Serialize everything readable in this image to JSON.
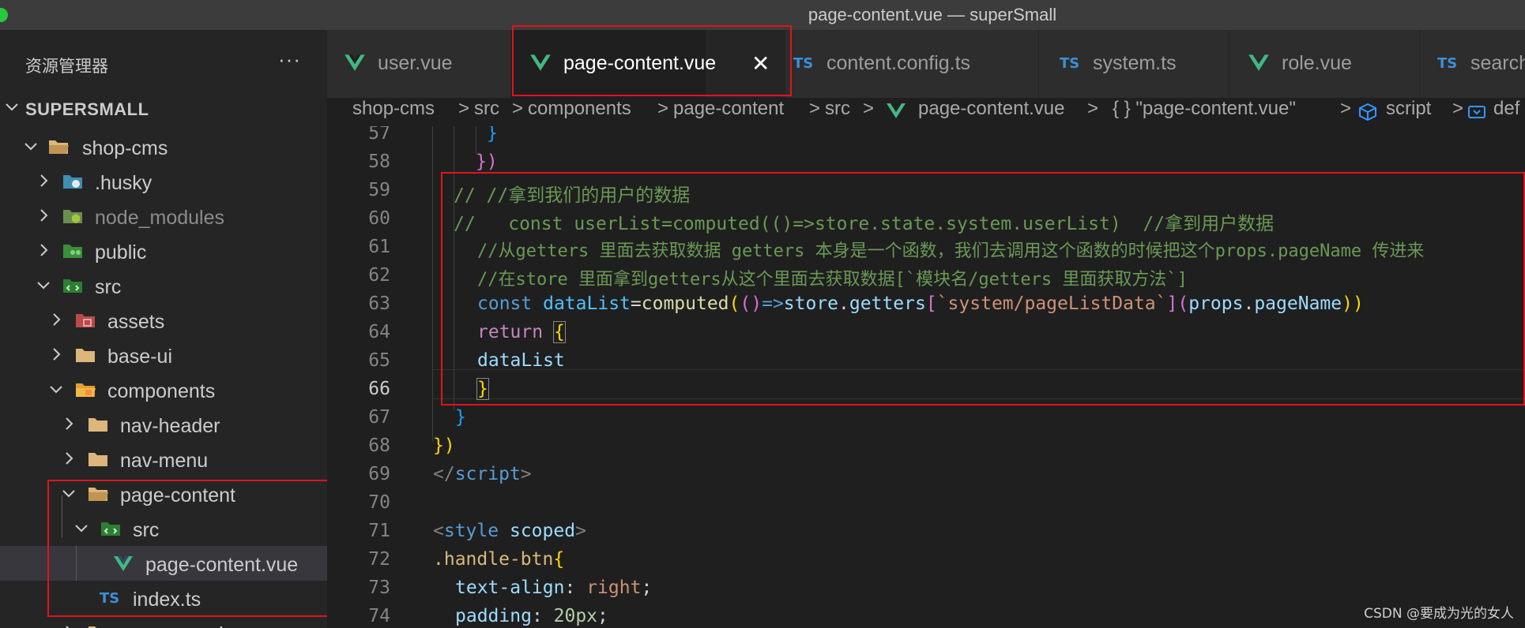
{
  "window": {
    "title": "page-content.vue — superSmall"
  },
  "explorer": {
    "title": "资源管理器",
    "more": "···",
    "project": "SUPERSMALL",
    "items": [
      {
        "label": "shop-cms"
      },
      {
        "label": ".husky"
      },
      {
        "label": "node_modules"
      },
      {
        "label": "public"
      },
      {
        "label": "src"
      },
      {
        "label": "assets"
      },
      {
        "label": "base-ui"
      },
      {
        "label": "components"
      },
      {
        "label": "nav-header"
      },
      {
        "label": "nav-menu"
      },
      {
        "label": "page-content"
      },
      {
        "label": "src"
      },
      {
        "label": "page-content.vue"
      },
      {
        "label": "index.ts"
      },
      {
        "label": "page-search"
      }
    ]
  },
  "tabs": [
    {
      "label": "user.vue",
      "icon": "vue-icon"
    },
    {
      "label": "page-content.vue",
      "icon": "vue-icon",
      "close": "✕"
    },
    {
      "label": "content.config.ts",
      "icon": "ts-icon",
      "badge": "TS"
    },
    {
      "label": "system.ts",
      "icon": "ts-icon",
      "badge": "TS"
    },
    {
      "label": "role.vue",
      "icon": "vue-icon"
    },
    {
      "label": "search",
      "icon": "ts-icon",
      "badge": "TS"
    }
  ],
  "breadcrumb": {
    "items": [
      "shop-cms",
      "src",
      "components",
      "page-content",
      "src",
      "page-content.vue",
      "{ } \"page-content.vue\"",
      "script",
      "def"
    ],
    "sep": ">"
  },
  "editor": {
    "current_line": 66,
    "lines": [
      {
        "n": "57",
        "t": "}"
      },
      {
        "n": "58",
        "t": "})"
      },
      {
        "n": "59",
        "t": "// //拿到我们的用户的数据"
      },
      {
        "n": "60",
        "t": "//   const userList=computed(()=>store.state.system.userList)  //拿到用户数据"
      },
      {
        "n": "61",
        "t": "//从getters 里面去获取数据 getters 本身是一个函数，我们去调用这个函数的时候把这个props.pageName 传进来"
      },
      {
        "n": "62",
        "t": "//在store 里面拿到getters从这个里面去获取数据[`模块名/getters 里面获取方法`]"
      },
      {
        "n": "63",
        "a": "const",
        "b": "dataList",
        "c": "=",
        "d": "computed",
        "e": "(",
        "f": "()",
        "g": "=>",
        "h": "store",
        "i": ".",
        "j": "getters",
        "k": "[",
        "l": "`system/pageListData`",
        "m": "]",
        "o": "(",
        "p": "props",
        "q": ".",
        "r": "pageName",
        "s": "))"
      },
      {
        "n": "64",
        "a": "return",
        "b": "{"
      },
      {
        "n": "65",
        "t": "dataList"
      },
      {
        "n": "66",
        "t": "}"
      },
      {
        "n": "67",
        "t": "}"
      },
      {
        "n": "68",
        "t": "})"
      },
      {
        "n": "69",
        "a": "</",
        "b": "script",
        "c": ">"
      },
      {
        "n": "70",
        "t": ""
      },
      {
        "n": "71",
        "a": "<",
        "b": "style",
        "c": "scoped",
        "d": ">"
      },
      {
        "n": "72",
        "a": ".handle-btn",
        "b": "{"
      },
      {
        "n": "73",
        "a": "text-align",
        "b": ": ",
        "c": "right",
        "d": ";"
      },
      {
        "n": "74",
        "a": "padding",
        "b": ": ",
        "c": "20px",
        "d": ";"
      }
    ]
  },
  "watermark": "CSDN @要成为光的女人",
  "colors": {
    "annotation_box": "#e0141a",
    "vue": "#41b883",
    "ts": "#3d8fd6"
  }
}
